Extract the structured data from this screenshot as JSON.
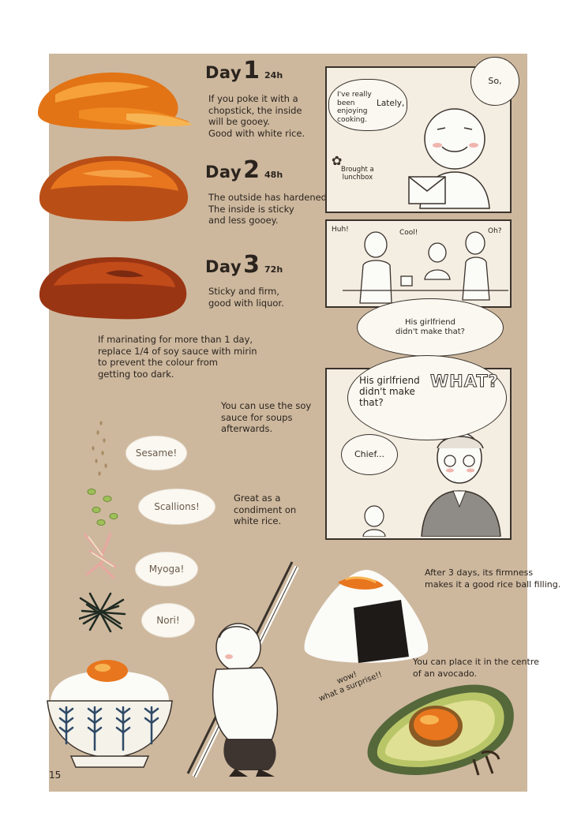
{
  "days": [
    {
      "word": "Day",
      "num": "1",
      "hours": "24h",
      "lines": [
        "If you poke it with a",
        "chopstick, the inside",
        "will be gooey.",
        "Good with white rice."
      ]
    },
    {
      "word": "Day",
      "num": "2",
      "hours": "48h",
      "lines": [
        "The outside has hardened.",
        "The inside is sticky",
        "and less gooey."
      ]
    },
    {
      "word": "Day",
      "num": "3",
      "hours": "72h",
      "lines": [
        "Sticky and firm,",
        "good with liquor."
      ]
    }
  ],
  "notes": {
    "marinate": [
      "If marinating for more than 1 day,",
      "replace 1/4 of soy sauce with mirin",
      "to prevent the colour from",
      "getting too dark."
    ],
    "soy": [
      "You can use the soy",
      "sauce for soups",
      "afterwards."
    ],
    "condiment": [
      "Great as a",
      "condiment on",
      "white rice."
    ],
    "riceball": [
      "After 3 days, its firmness",
      "makes it a good rice ball filling."
    ],
    "avocado": [
      "You can place it in the centre",
      "of an avocado."
    ],
    "wow": [
      "wow!",
      "what a surprise!!"
    ]
  },
  "toppings": [
    "Sesame!",
    "Scallions!",
    "Myoga!",
    "Nori!"
  ],
  "comic": {
    "p1": {
      "so": "So,",
      "lately": "Lately,",
      "enjoying": [
        "I've really",
        "been",
        "enjoying",
        "cooking."
      ],
      "brought": [
        "Brought a",
        "lunchbox"
      ]
    },
    "p2": {
      "huh": "Huh!",
      "cool": "Cool!",
      "oh": "Oh?",
      "girlfriend": [
        "His girlfriend",
        "didn't make that?"
      ]
    },
    "p3": {
      "girlfriend": [
        "His girlfriend",
        "didn't make",
        "that?"
      ],
      "what": "WHAT?",
      "chief": "Chief..."
    }
  },
  "page_number": "15",
  "colors": {
    "background": "#cdb89e",
    "panel": "#f4ede2",
    "yolk": "#e8761e"
  }
}
